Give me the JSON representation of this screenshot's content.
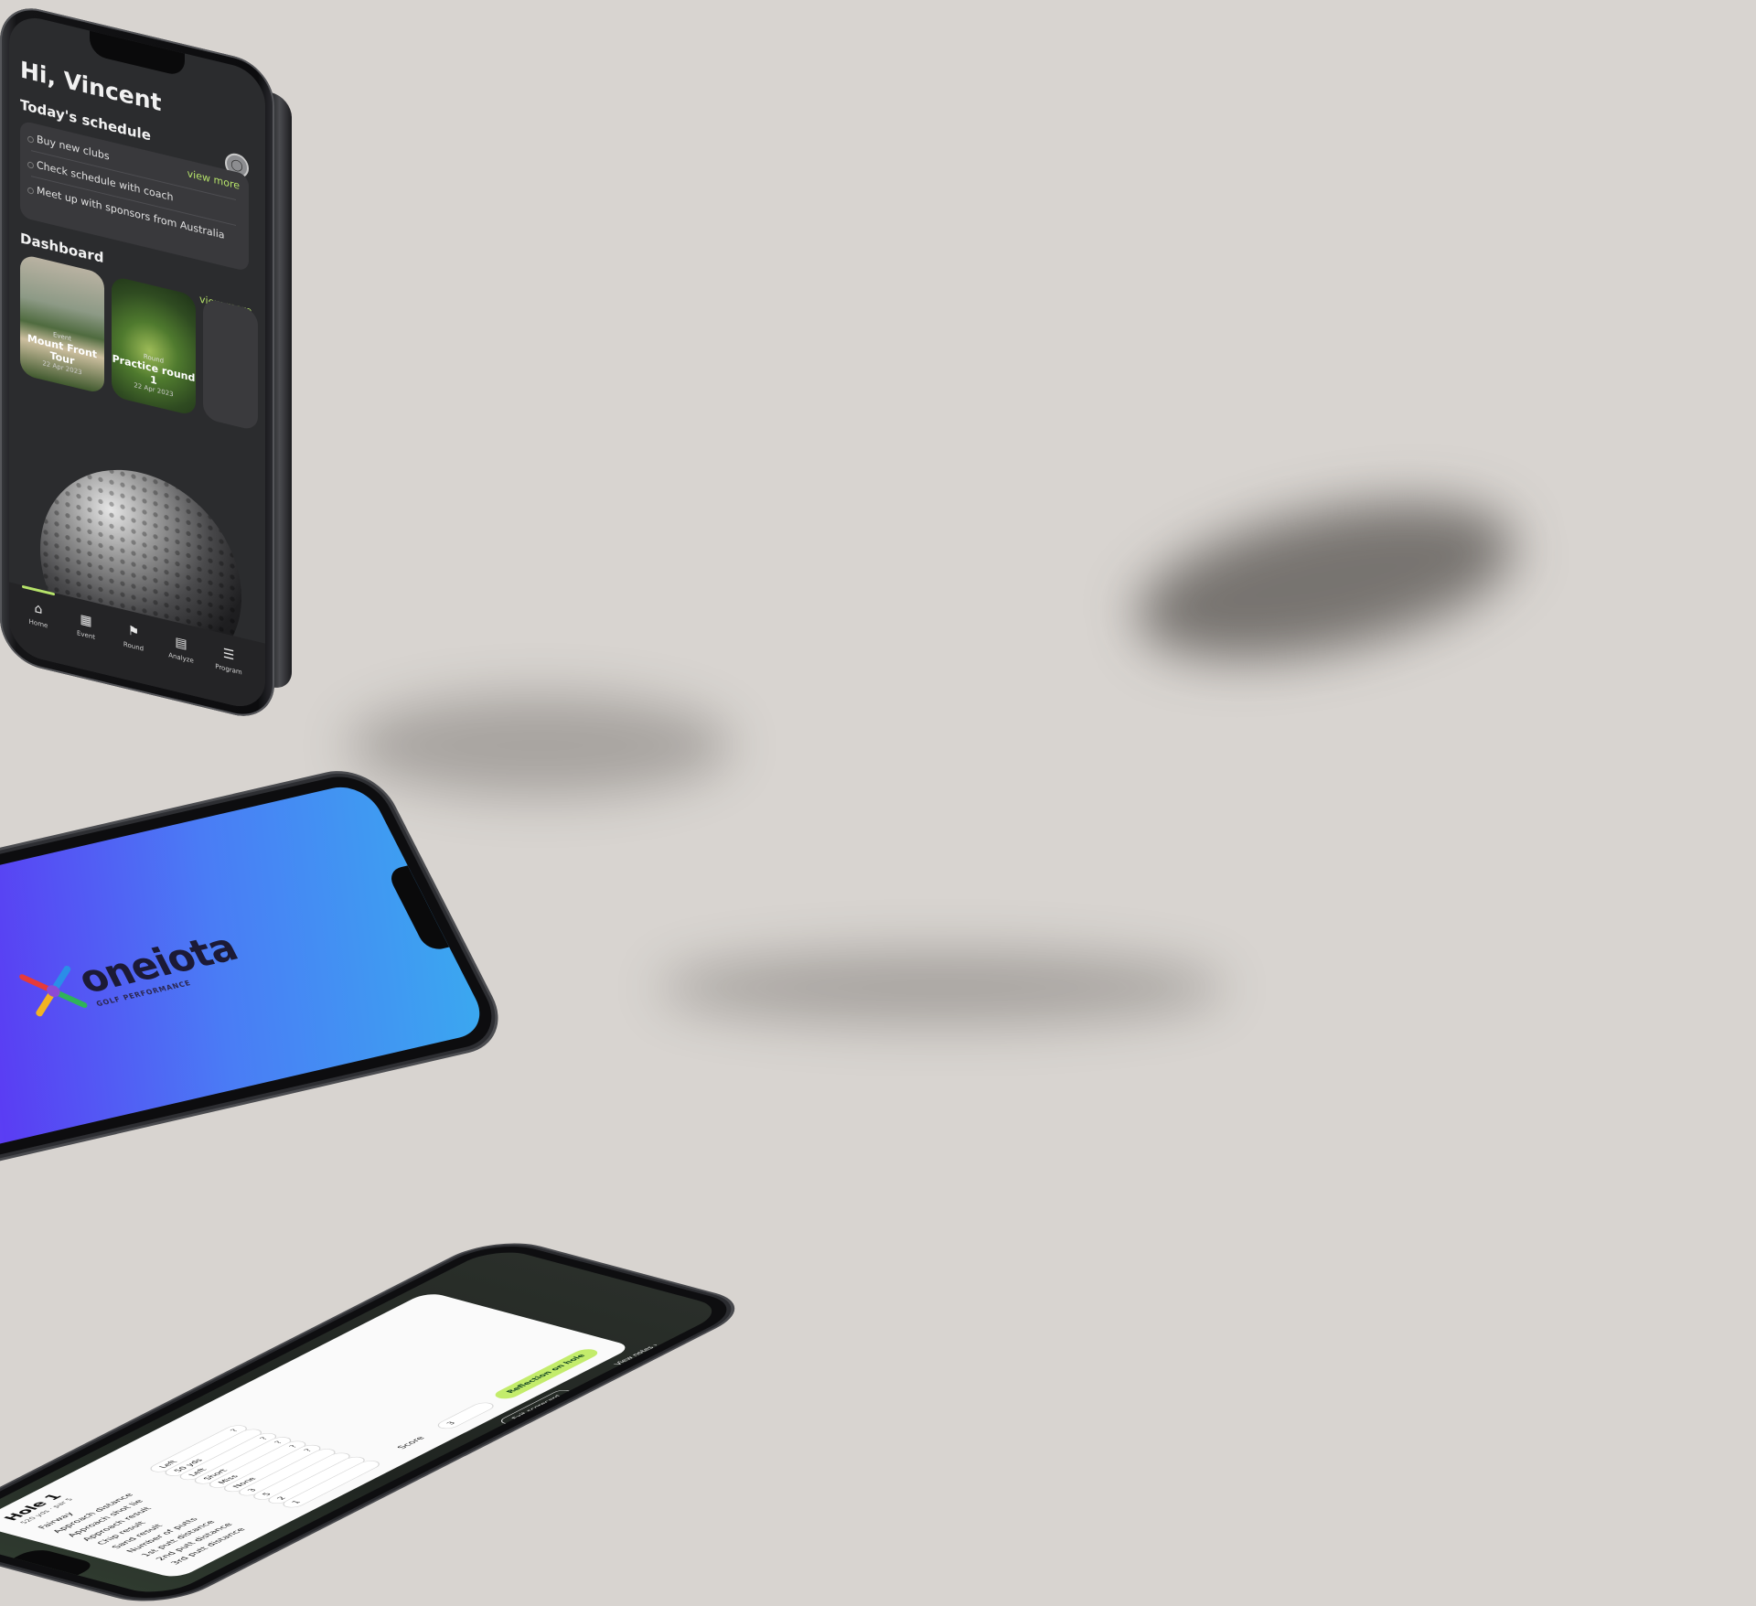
{
  "home": {
    "greeting": "Hi, Vincent",
    "schedule_title": "Today's schedule",
    "schedule_items": [
      "Buy new clubs",
      "Check schedule with coach",
      "Meet up with sponsors from Australia"
    ],
    "view_more": "view more",
    "dashboard_title": "Dashboard",
    "dashboard_view_more": "view more",
    "cards": [
      {
        "type": "Event",
        "name": "Mount Front Tour",
        "date": "22 Apr 2023"
      },
      {
        "type": "Round",
        "name": "Practice round 1",
        "date": "22 Apr 2023"
      }
    ],
    "tabs": [
      "Home",
      "Event",
      "Round",
      "Analyze",
      "Program"
    ],
    "tab_icons": [
      "home-icon",
      "calendar-icon",
      "flag-icon",
      "document-icon",
      "list-icon"
    ],
    "accent": "#b6e36a"
  },
  "splash": {
    "logo_text": "oneiota",
    "logo_sub": "GOLF PERFORMANCE"
  },
  "scorecard": {
    "hole_title": "Hole 1",
    "hole_sub": "520 yds · par 5",
    "rows": [
      {
        "label": "Fairway",
        "values": [
          "Left"
        ]
      },
      {
        "label": "Approach distance",
        "values": [
          "50 yds"
        ]
      },
      {
        "label": "Approach shot lie",
        "values": [
          "Left"
        ]
      },
      {
        "label": "Approach result",
        "values": [
          "Short"
        ]
      },
      {
        "label": "Chip result",
        "values": [
          "Miss"
        ]
      },
      {
        "label": "Sand result",
        "values": [
          "None"
        ]
      },
      {
        "label": "Number of putts",
        "values": [
          "3"
        ]
      },
      {
        "label": "1st putt distance",
        "values": [
          "5"
        ]
      },
      {
        "label": "2nd putt distance",
        "values": [
          "2"
        ]
      },
      {
        "label": "3rd putt distance",
        "values": [
          "1"
        ]
      },
      {
        "label": "Score",
        "values": [
          "3"
        ]
      }
    ],
    "reflection_button": "Reflection on hole",
    "exit_button": "Exit scorecard",
    "view_button": "View notes"
  }
}
